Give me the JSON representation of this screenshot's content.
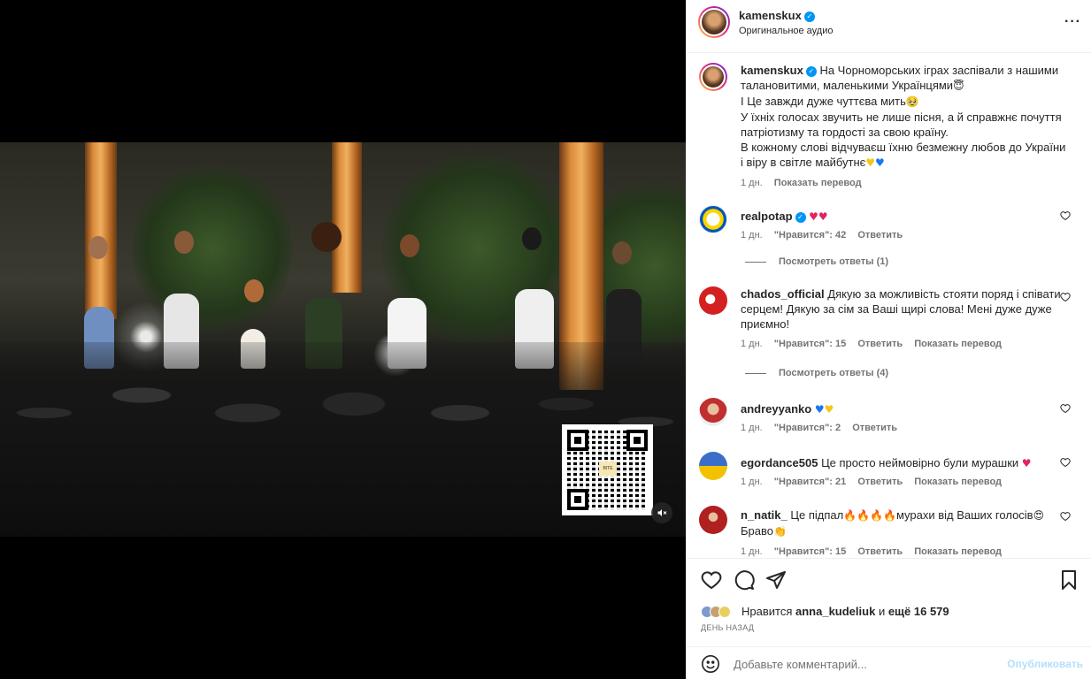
{
  "post": {
    "username": "kamenskux",
    "audio": "Оригинальное аудио"
  },
  "caption": {
    "username": "kamenskux",
    "lines": [
      "На Чорноморських іграх заспівали з нашими",
      "талановитими, маленькими Українцями",
      "І Це завжди дуже чуттєва мить",
      "У їхніх голосах звучить не лише пісня, а й справжнє почуття",
      "патріотизму та гордості за свою країну.",
      "В кожному слові відчуваєш їхню безмежну любов до України",
      "і віру в світле майбутнє"
    ],
    "time": "1 дн.",
    "translate": "Показать перевод"
  },
  "comments": [
    {
      "user": "realpotap",
      "text": "",
      "time": "1 дн.",
      "likes": "\"Нравится\": 42",
      "reply": "Ответить",
      "translate": ""
    },
    {
      "user": "chados_official",
      "text": "Дякую за можливість стояти поряд і співати серцем! Дякую за сім за Ваші щирі слова! Мені дуже дуже приємно!",
      "time": "1 дн.",
      "likes": "\"Нравится\": 15",
      "reply": "Ответить",
      "translate": "Показать перевод"
    },
    {
      "user": "andreyyanko",
      "text": "",
      "time": "1 дн.",
      "likes": "\"Нравится\": 2",
      "reply": "Ответить",
      "translate": ""
    },
    {
      "user": "egordance505",
      "text": "Це просто неймовірно були мурашки",
      "time": "1 дн.",
      "likes": "\"Нравится\": 21",
      "reply": "Ответить",
      "translate": "Показать перевод"
    },
    {
      "user": "n_natik_",
      "text": "Це підпал",
      "text2": "мурахи від Ваших голосів",
      "text3": "Браво",
      "time": "1 дн.",
      "likes": "\"Нравится\": 15",
      "reply": "Ответить",
      "translate": "Показать перевод"
    }
  ],
  "replies": [
    "Посмотреть ответы (1)",
    "Посмотреть ответы (4)"
  ],
  "likes_line": {
    "prefix": "Нравится",
    "user": "anna_kudeliuk",
    "middle": "и",
    "rest": "ещё 16 579"
  },
  "date": "День назад",
  "add_comment": {
    "placeholder": "Добавьте комментарий...",
    "post_label": "Опубликовать"
  },
  "qr_logo": "BITE"
}
